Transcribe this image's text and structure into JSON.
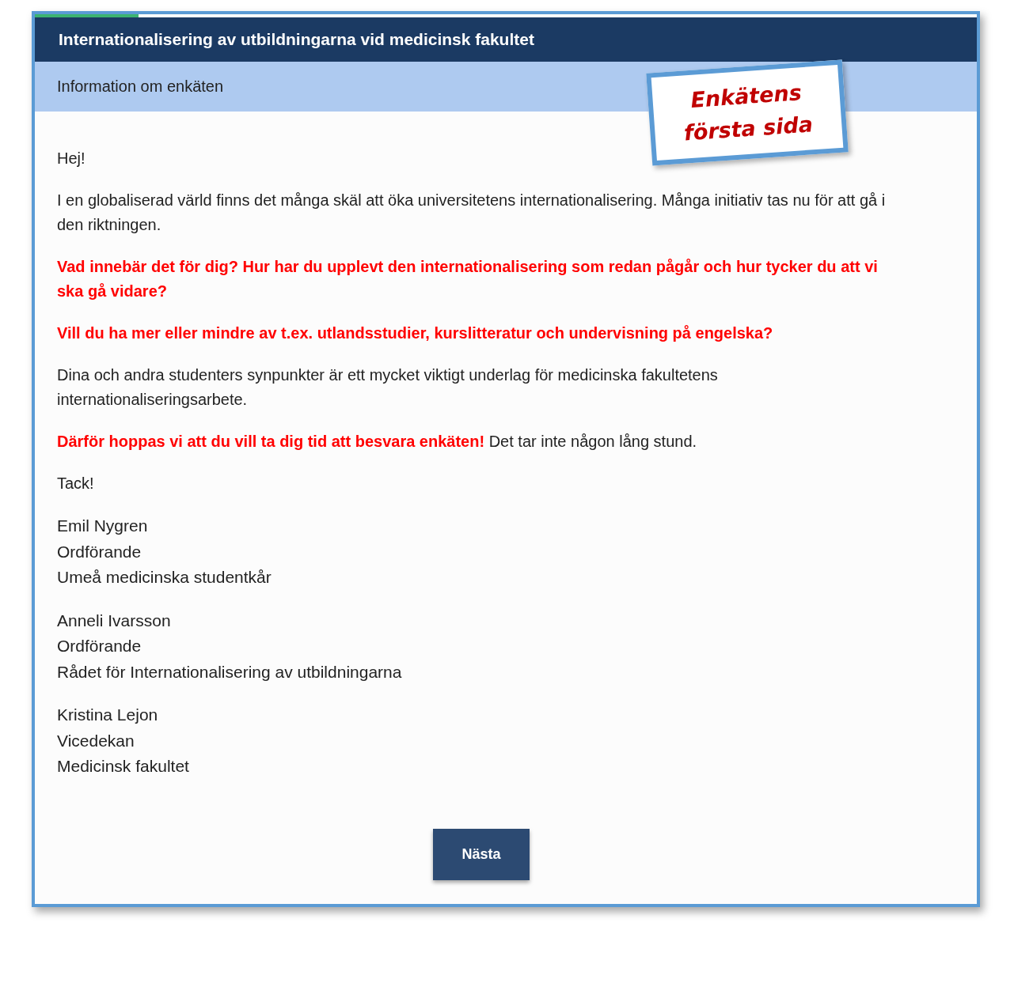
{
  "progress": {
    "level": 0.11
  },
  "header": {
    "title": "Internationalisering av utbildningarna vid medicinsk fakultet"
  },
  "subheader": {
    "title": "Information om enkäten"
  },
  "note": {
    "lines": [
      "Enkätens",
      "första sida"
    ]
  },
  "paragraphs": [
    {
      "kind": "plain",
      "text": "Hej!"
    },
    {
      "kind": "plain",
      "text": "I en globaliserad värld finns det många skäl att öka universitetens internationalisering. Många initiativ tas nu för att gå i den riktningen."
    },
    {
      "kind": "highlight",
      "text": "Vad innebär det för dig? Hur har du upplevt den internationalisering som redan pågår och hur tycker du att vi ska gå vidare?"
    },
    {
      "kind": "highlight",
      "text": "Vill du ha mer eller mindre av t.ex. utlandsstudier, kurslitteratur och undervisning på engelska?"
    },
    {
      "kind": "plain",
      "text": "Dina och andra studenters synpunkter är ett mycket viktigt underlag för medicinska fakultetens internationaliseringsarbete."
    },
    {
      "kind": "plain",
      "text": "**Därför hoppas vi att du vill ta dig tid att besvara enkäten!** Det tar inte någon lång stund."
    },
    {
      "kind": "plain",
      "text": "Tack!"
    }
  ],
  "signatures": [
    {
      "lines": [
        "Emil Nygren",
        "Ordförande",
        "Umeå medicinska studentkår"
      ]
    },
    {
      "lines": [
        "Anneli Ivarsson",
        "Ordförande",
        "Rådet för Internationalisering av utbildningarna"
      ]
    },
    {
      "lines": [
        "Kristina Lejon",
        "Vicedekan",
        "Medicinsk fakultet"
      ]
    }
  ],
  "next_button": {
    "label": "Nästa"
  }
}
